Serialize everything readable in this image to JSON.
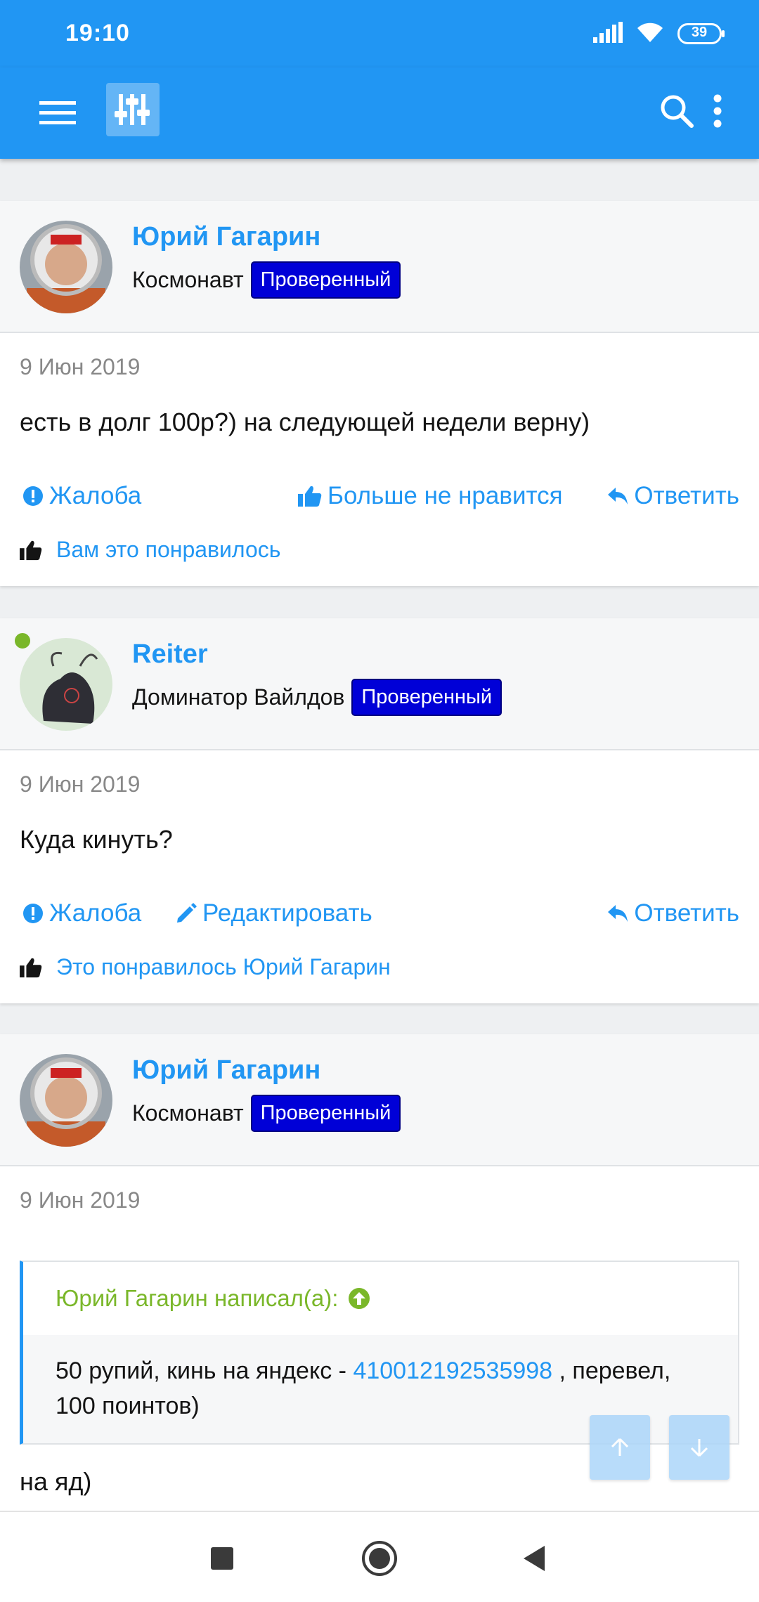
{
  "status_bar": {
    "time": "19:10",
    "battery": "39"
  },
  "app_bar": {
    "menu_icon": "hamburger-icon",
    "logo_icon": "sliders-logo-icon",
    "search_icon": "search-icon",
    "more_icon": "more-vertical-icon"
  },
  "posts": [
    {
      "author": "Юрий Гагарин",
      "user_title": "Космонавт",
      "badge": "Проверенный",
      "date": "9 Июн 2019",
      "body": "есть в долг 100р?) на следующей недели верну)",
      "actions": {
        "report": "Жалоба",
        "like": "Больше не нравится",
        "reply": "Ответить"
      },
      "likes": "Вам это понравилось"
    },
    {
      "author": "Reiter",
      "user_title": "Доминатор Вайлдов",
      "badge": "Проверенный",
      "date": "9 Июн 2019",
      "body": "Куда кинуть?",
      "actions": {
        "report": "Жалоба",
        "edit": "Редактировать",
        "reply": "Ответить"
      },
      "likes": "Это понравилось Юрий Гагарин"
    },
    {
      "author": "Юрий Гагарин",
      "user_title": "Космонавт",
      "badge": "Проверенный",
      "date": "9 Июн 2019",
      "quote": {
        "header": "Юрий Гагарин написал(а):",
        "text_before": "50 рупий, кинь на яндекс - ",
        "link": "410012192535998",
        "text_after": " , перевел,",
        "line2": "100 поинтов)"
      },
      "body": "на яд)"
    }
  ],
  "colors": {
    "primary": "#2196f3",
    "badge": "#0000d7",
    "online": "#7ab72a",
    "quote_accent": "#7ab72a"
  }
}
